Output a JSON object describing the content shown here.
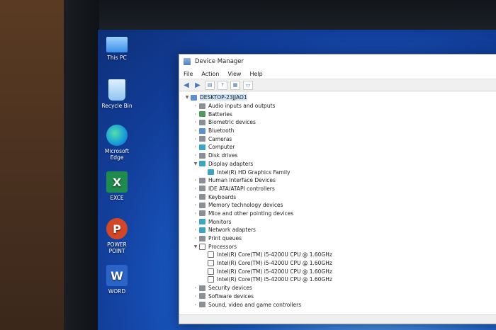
{
  "desktop": {
    "icons": [
      {
        "label": "This PC",
        "icon": "this-pc-icon"
      },
      {
        "label": "Recycle Bin",
        "icon": "recycle-bin-icon"
      },
      {
        "label": "Microsoft Edge",
        "icon": "edge-icon"
      },
      {
        "label": "EXCE",
        "icon": "excel-icon"
      },
      {
        "label": "POWER POINT",
        "icon": "powerpoint-icon"
      },
      {
        "label": "WORD",
        "icon": "word-icon"
      }
    ]
  },
  "window": {
    "title": "Device Manager",
    "menu": [
      "File",
      "Action",
      "View",
      "Help"
    ]
  },
  "tree": {
    "root": "DESKTOP-23JJAO1",
    "items": [
      {
        "label": "Audio inputs and outputs",
        "expanded": false
      },
      {
        "label": "Batteries",
        "expanded": false
      },
      {
        "label": "Biometric devices",
        "expanded": false
      },
      {
        "label": "Bluetooth",
        "expanded": false
      },
      {
        "label": "Cameras",
        "expanded": false
      },
      {
        "label": "Computer",
        "expanded": false
      },
      {
        "label": "Disk drives",
        "expanded": false
      },
      {
        "label": "Display adapters",
        "expanded": true,
        "children": [
          "Intel(R) HD Graphics Family"
        ]
      },
      {
        "label": "Human Interface Devices",
        "expanded": false
      },
      {
        "label": "IDE ATA/ATAPI controllers",
        "expanded": false
      },
      {
        "label": "Keyboards",
        "expanded": false
      },
      {
        "label": "Memory technology devices",
        "expanded": false
      },
      {
        "label": "Mice and other pointing devices",
        "expanded": false
      },
      {
        "label": "Monitors",
        "expanded": false
      },
      {
        "label": "Network adapters",
        "expanded": false
      },
      {
        "label": "Print queues",
        "expanded": false
      },
      {
        "label": "Processors",
        "expanded": true,
        "children": [
          "Intel(R) Core(TM) i5-4200U CPU @ 1.60GHz",
          "Intel(R) Core(TM) i5-4200U CPU @ 1.60GHz",
          "Intel(R) Core(TM) i5-4200U CPU @ 1.60GHz",
          "Intel(R) Core(TM) i5-4200U CPU @ 1.60GHz"
        ]
      },
      {
        "label": "Security devices",
        "expanded": false
      },
      {
        "label": "Software devices",
        "expanded": false
      },
      {
        "label": "Sound, video and game controllers",
        "expanded": false
      }
    ]
  }
}
